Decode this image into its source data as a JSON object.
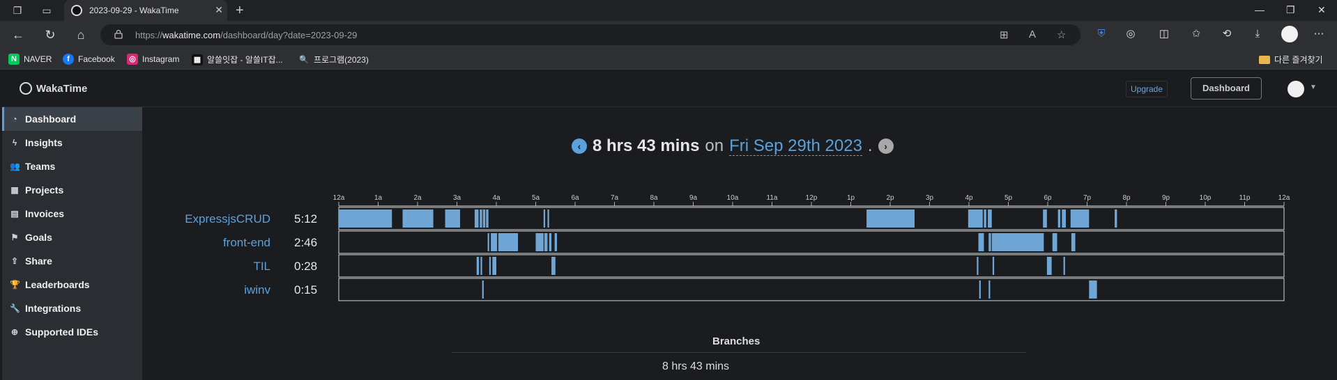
{
  "browser": {
    "tab_title": "2023-09-29 - WakaTime",
    "url_prefix": "https://",
    "url_domain": "wakatime.com",
    "url_path": "/dashboard/day?date=2023-09-29",
    "bookmarks": [
      {
        "label": "NAVER",
        "icon": "naver-icon",
        "color": "#03c75a",
        "glyph": "N"
      },
      {
        "label": "Facebook",
        "icon": "facebook-icon",
        "color": "#1877f2",
        "glyph": "f"
      },
      {
        "label": "Instagram",
        "icon": "instagram-icon",
        "color": "#d62976",
        "glyph": "◎"
      },
      {
        "label": "알쓸잇잡 - 알쓸IT잡...",
        "icon": "site-icon",
        "color": "#111111",
        "glyph": "▦"
      },
      {
        "label": "프로그램(2023)",
        "icon": "search-icon",
        "color": "#2e2f32",
        "glyph": "🔍"
      }
    ],
    "other_bookmarks": "다른 즐겨찾기"
  },
  "app": {
    "logo_text": "WakaTime",
    "upgrade_label": "Upgrade",
    "dashboard_label": "Dashboard"
  },
  "sidebar": {
    "items": [
      {
        "label": "Dashboard",
        "icon": "dashboard-icon",
        "glyph": "◔",
        "active": true
      },
      {
        "label": "Insights",
        "icon": "bolt-icon",
        "glyph": "ϟ",
        "active": false
      },
      {
        "label": "Teams",
        "icon": "users-icon",
        "glyph": "👥",
        "active": false
      },
      {
        "label": "Projects",
        "icon": "grid-icon",
        "glyph": "▦",
        "active": false
      },
      {
        "label": "Invoices",
        "icon": "file-icon",
        "glyph": "▤",
        "active": false
      },
      {
        "label": "Goals",
        "icon": "flag-icon",
        "glyph": "⚑",
        "active": false
      },
      {
        "label": "Share",
        "icon": "share-icon",
        "glyph": "⇪",
        "active": false
      },
      {
        "label": "Leaderboards",
        "icon": "trophy-icon",
        "glyph": "🏆",
        "active": false
      },
      {
        "label": "Integrations",
        "icon": "wrench-icon",
        "glyph": "🔧",
        "active": false
      },
      {
        "label": "Supported IDEs",
        "icon": "plus-circle-icon",
        "glyph": "⊕",
        "active": false
      }
    ]
  },
  "summary": {
    "total": "8 hrs 43 mins",
    "on": "on",
    "date_label": "Fri Sep 29th 2023",
    "period": "."
  },
  "colors": {
    "accent": "#5aa2db",
    "bar": "#6fa6d6",
    "page_bg": "#1a1c1f",
    "sidebar_bg": "#2a2e33"
  },
  "chart_data": {
    "type": "timeline",
    "x_ticks": [
      "12a",
      "1a",
      "2a",
      "3a",
      "4a",
      "5a",
      "6a",
      "7a",
      "8a",
      "9a",
      "10a",
      "11a",
      "12p",
      "1p",
      "2p",
      "3p",
      "4p",
      "5p",
      "6p",
      "7p",
      "8p",
      "9p",
      "10p",
      "11p",
      "12a"
    ],
    "x_range_hours": [
      0,
      24
    ],
    "projects": [
      {
        "name": "ExpressjsCRUD",
        "total": "5:12",
        "segments": [
          [
            0.0,
            1.35
          ],
          [
            1.62,
            2.4
          ],
          [
            2.7,
            3.08
          ],
          [
            3.45,
            3.55
          ],
          [
            3.58,
            3.64
          ],
          [
            3.66,
            3.72
          ],
          [
            3.74,
            3.8
          ],
          [
            5.2,
            5.24
          ],
          [
            5.3,
            5.34
          ],
          [
            13.4,
            14.62
          ],
          [
            15.98,
            16.35
          ],
          [
            16.38,
            16.44
          ],
          [
            16.48,
            16.58
          ],
          [
            17.88,
            17.98
          ],
          [
            18.26,
            18.32
          ],
          [
            18.36,
            18.46
          ],
          [
            18.58,
            19.05
          ],
          [
            19.7,
            19.76
          ]
        ]
      },
      {
        "name": "front-end",
        "total": "2:46",
        "segments": [
          [
            3.78,
            3.82
          ],
          [
            3.86,
            4.02
          ],
          [
            4.05,
            4.55
          ],
          [
            5.0,
            5.2
          ],
          [
            5.22,
            5.3
          ],
          [
            5.34,
            5.4
          ],
          [
            5.48,
            5.54
          ],
          [
            16.24,
            16.38
          ],
          [
            16.5,
            16.56
          ],
          [
            16.58,
            17.9
          ],
          [
            18.12,
            18.24
          ],
          [
            18.6,
            18.7
          ]
        ]
      },
      {
        "name": "TIL",
        "total": "0:28",
        "segments": [
          [
            3.5,
            3.56
          ],
          [
            3.6,
            3.64
          ],
          [
            3.82,
            3.86
          ],
          [
            3.9,
            4.0
          ],
          [
            5.4,
            5.5
          ],
          [
            16.2,
            16.24
          ],
          [
            16.6,
            16.64
          ],
          [
            17.98,
            18.1
          ],
          [
            18.4,
            18.44
          ]
        ]
      },
      {
        "name": "iwinv",
        "total": "0:15",
        "segments": [
          [
            3.64,
            3.68
          ],
          [
            16.26,
            16.3
          ],
          [
            16.5,
            16.54
          ],
          [
            19.05,
            19.25
          ]
        ]
      }
    ]
  },
  "branches": {
    "title": "Branches",
    "total": "8 hrs 43 mins"
  }
}
